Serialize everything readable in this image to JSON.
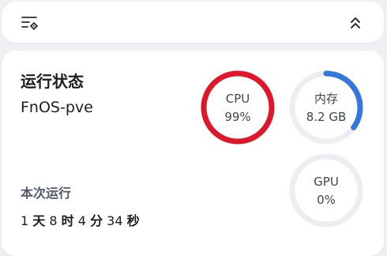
{
  "toolbar": {
    "left_icon": "settings-list-icon",
    "right_icon": "double-chevron-up-icon"
  },
  "status": {
    "title": "运行状态",
    "hostname": "FnOS-pve",
    "uptime_label": "本次运行",
    "uptime": {
      "days": "1",
      "days_unit": "天",
      "hours": "8",
      "hours_unit": "时",
      "minutes": "4",
      "minutes_unit": "分",
      "seconds": "34",
      "seconds_unit": "秒"
    }
  },
  "gauges": [
    {
      "id": "cpu",
      "label": "CPU",
      "value": "99%",
      "fraction": 0.99,
      "color": "#e0162b"
    },
    {
      "id": "memory",
      "label": "内存",
      "value": "8.2 GB",
      "fraction": 0.35,
      "color": "#3476dc"
    },
    {
      "id": "gpu",
      "label": "GPU",
      "value": "0%",
      "fraction": 0.0,
      "color": "#3476dc"
    }
  ],
  "colors": {
    "track": "#eceef1",
    "background": "#eef0f3",
    "card": "#ffffff"
  }
}
